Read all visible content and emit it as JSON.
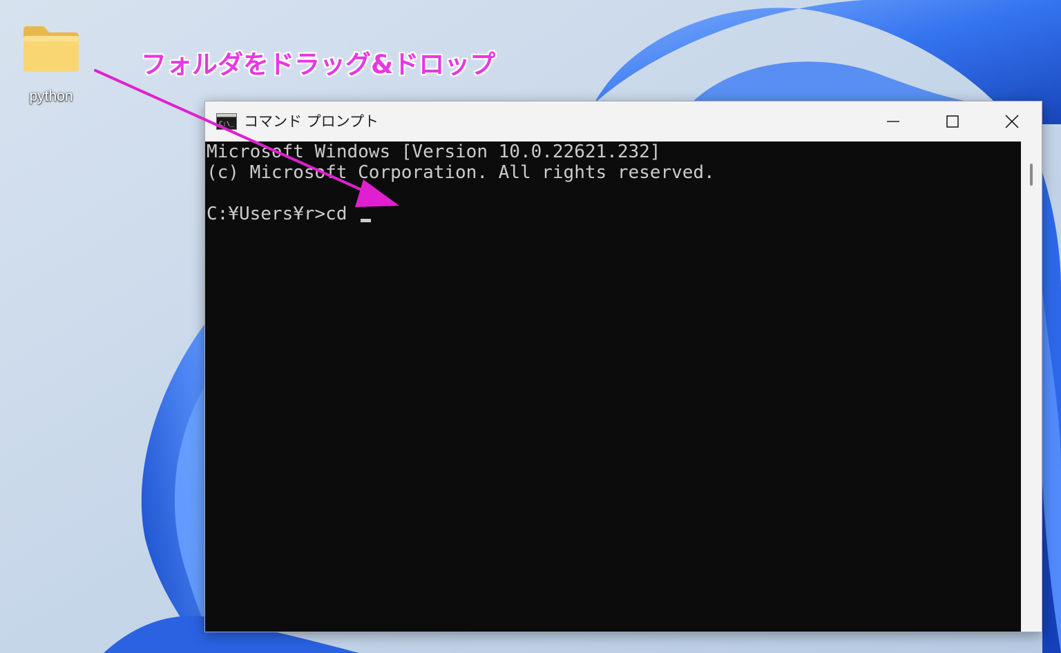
{
  "desktop": {
    "folder_label": "python"
  },
  "annotation": {
    "text": "フォルダをドラッグ&ドロップ",
    "color": "#e838e0"
  },
  "window": {
    "title": "コマンド プロンプト",
    "controls": {
      "minimize_icon": "minimize-icon",
      "maximize_icon": "maximize-icon",
      "close_icon": "close-icon"
    }
  },
  "console": {
    "lines": [
      "Microsoft Windows [Version 10.0.22621.232]",
      "(c) Microsoft Corporation. All rights reserved.",
      "",
      "C:¥Users¥r>cd "
    ],
    "background": "#0c0c0c",
    "foreground": "#cccccc"
  },
  "colors": {
    "wallpaper_blue": "#1f5fe0",
    "wallpaper_bg": "#c6d6e8",
    "arrow": "#e020d0"
  }
}
